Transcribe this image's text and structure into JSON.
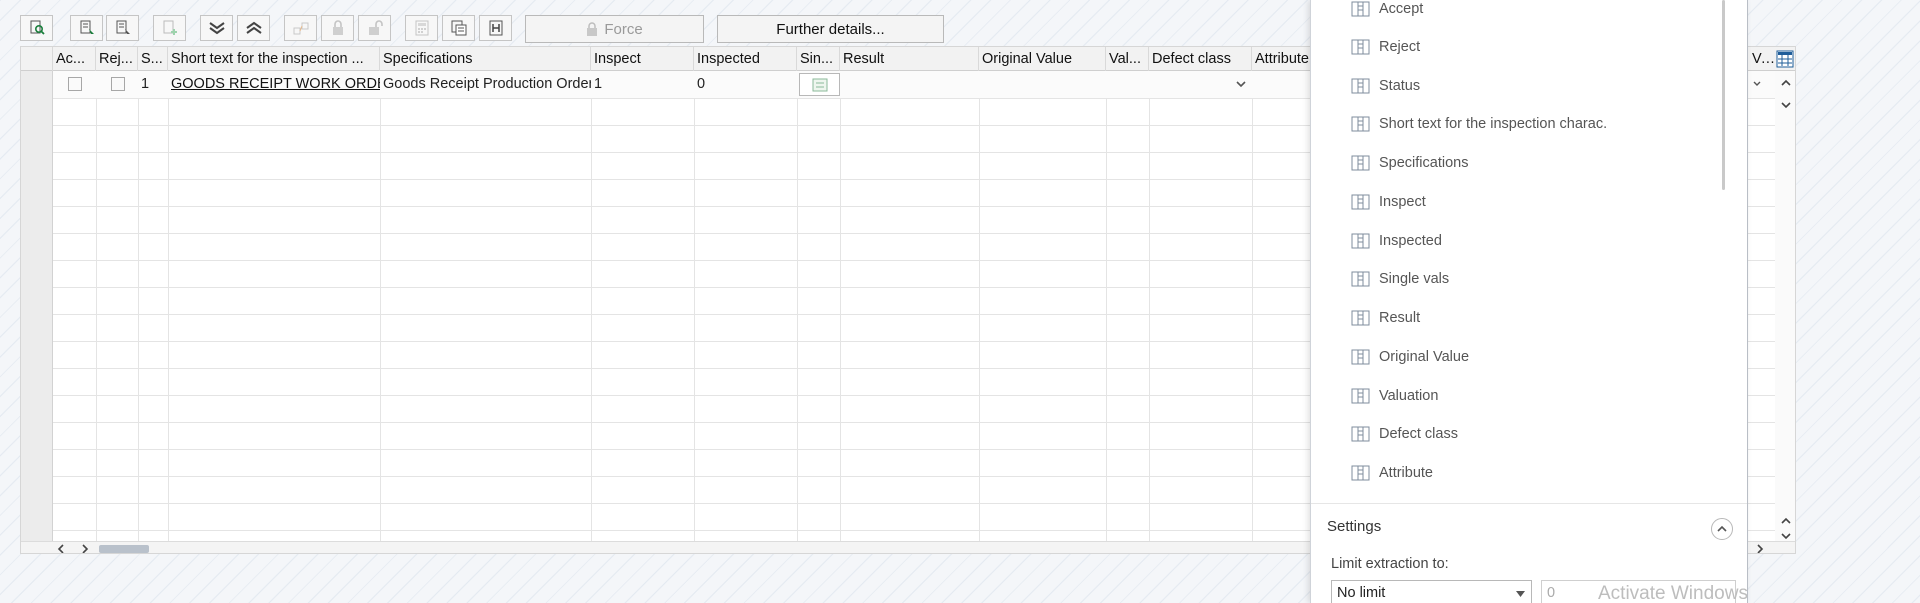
{
  "toolbar": {
    "force_label": "Force",
    "further_details_label": "Further details..."
  },
  "table": {
    "columns": [
      "Ac...",
      "Rej...",
      "S...",
      "Short text for the inspection ...",
      "Specifications",
      "Inspect",
      "Inspected",
      "Sin...",
      "Result",
      "Original Value",
      "Val...",
      "Defect class",
      "Attribute",
      "Valdat"
    ],
    "row": {
      "seq": "1",
      "short_text": "GOODS RECEIPT WORK ORDE",
      "specifications": "Goods Receipt Production Order",
      "inspect": "1",
      "inspected": "0"
    }
  },
  "panel": {
    "fields": [
      "Accept",
      "Reject",
      "Status",
      "Short text for the inspection charac.",
      "Specifications",
      "Inspect",
      "Inspected",
      "Single vals",
      "Result",
      "Original Value",
      "Valuation",
      "Defect class",
      "Attribute"
    ],
    "settings_title": "Settings",
    "limit_label": "Limit extraction to:",
    "limit_value": "No limit",
    "limit_count": "0"
  },
  "watermark": "Activate Windows"
}
